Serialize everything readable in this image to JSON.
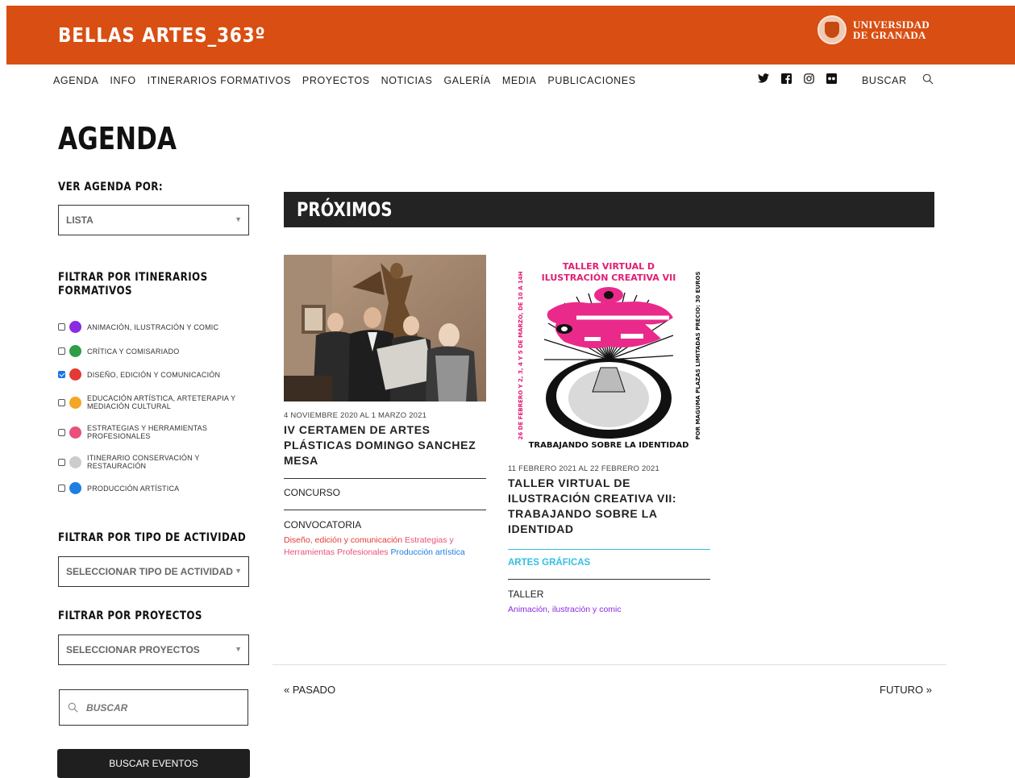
{
  "header": {
    "brand": "BELLAS ARTES_363º",
    "university_line1": "UNIVERSIDAD",
    "university_line2": "DE GRANADA",
    "brand_color": "#d94e12"
  },
  "nav": {
    "items": [
      "AGENDA",
      "INFO",
      "ITINERARIOS FORMATIVOS",
      "PROYECTOS",
      "NOTICIAS",
      "GALERÍA",
      "MEDIA",
      "PUBLICACIONES"
    ],
    "social": [
      "twitter-icon",
      "facebook-icon",
      "instagram-icon",
      "flickr-icon"
    ],
    "search_label": "BUSCAR"
  },
  "page": {
    "title": "AGENDA"
  },
  "sidebar": {
    "view_heading": "VER AGENDA POR:",
    "view_select": "LISTA",
    "itinerary_heading_1": "FILTRAR POR ITINERARIOS",
    "itinerary_heading_2": "FORMATIVOS",
    "filters": [
      {
        "label": "ANIMACIÓN, ILUSTRACIÓN Y COMIC",
        "color": "#8a2be2",
        "checked": false
      },
      {
        "label": "CRÍTICA Y COMISARIADO",
        "color": "#2e9e46",
        "checked": false
      },
      {
        "label": "DISEÑO, EDICIÓN Y COMUNICACIÓN",
        "color": "#e53935",
        "checked": true
      },
      {
        "label": "EDUCACIÓN ARTÍSTICA, ARTETERAPIA Y",
        "label2": "MEDIACIÓN CULTURAL",
        "color": "#f5a623",
        "checked": false
      },
      {
        "label": "ESTRATEGIAS Y HERRAMIENTAS",
        "label2": "PROFESIONALES",
        "color": "#e8517a",
        "checked": false
      },
      {
        "label": "ITINERARIO CONSERVACIÓN Y",
        "label2": "RESTAURACIÓN",
        "color": "#cccccc",
        "checked": false
      },
      {
        "label": "PRODUCCIÓN ARTÍSTICA",
        "color": "#1e7fe0",
        "checked": false
      }
    ],
    "activity_heading": "FILTRAR POR TIPO DE ACTIVIDAD",
    "activity_select": "SELECCIONAR TIPO DE ACTIVIDAD",
    "projects_heading": "FILTRAR POR PROYECTOS",
    "projects_select": "SELECCIONAR PROYECTOS",
    "search_placeholder": "BUSCAR",
    "search_button": "BUSCAR EVENTOS"
  },
  "main": {
    "section_title": "PRÓXIMOS",
    "events": [
      {
        "date": "4 NOVIEMBRE 2020 AL 1 MARZO 2021",
        "title": "IV CERTAMEN DE ARTES PLÁSTICAS DOMINGO SANCHEZ MESA",
        "type": "CONCURSO",
        "category": "CONVOCATORIA",
        "tag_1": "Diseño, edición y comunicación",
        "tag_2": "Estrategias y Herramientas Profesionales",
        "tag_3": "Producción artística"
      },
      {
        "date": "11 FEBRERO 2021 AL 22 FEBRERO 2021",
        "title": "TALLER VIRTUAL DE ILUSTRACIÓN CREATIVA VII: TRABAJANDO SOBRE LA IDENTIDAD",
        "area": "ARTES GRÁFICAS",
        "type": "TALLER",
        "tag_1": "Animación, ilustración y comic",
        "poster": {
          "title_1": "TALLER VIRTUAL D",
          "title_2": "ILUSTRACIÓN CREATIVA VII",
          "left_text": "26 DE FEBRERO Y 2, 3, 4 Y 5 DE MARZO, DE 10 A 14H",
          "right_text": "POR MAGUMA PLAZAS LIMITADAS PRECIO: 30 EUROS",
          "bottom_text": "TRABAJANDO SOBRE LA IDENTIDAD"
        }
      }
    ],
    "prev_label": "« PASADO",
    "next_label": "FUTURO »"
  }
}
